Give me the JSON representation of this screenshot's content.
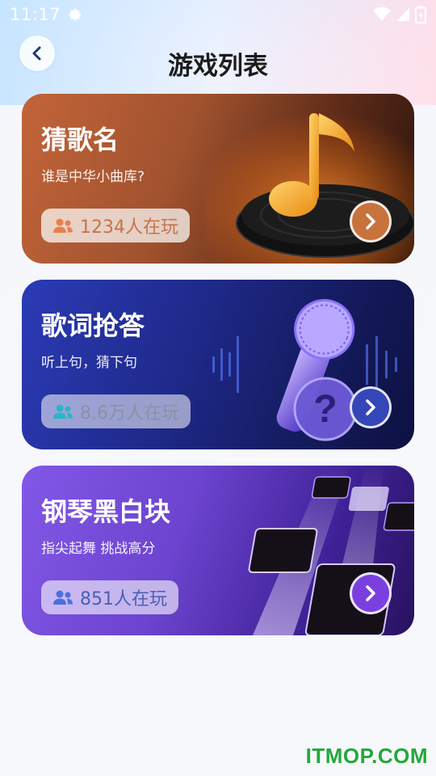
{
  "status": {
    "time": "11:17",
    "icons": [
      "gear-icon",
      "wifi-icon",
      "signal-icon",
      "battery-icon"
    ]
  },
  "header": {
    "back_icon": "chevron-left-icon",
    "title": "游戏列表"
  },
  "games": [
    {
      "title": "猜歌名",
      "subtitle": "谁是中华小曲库?",
      "players": "1234人在玩",
      "accent": "#c8733b",
      "art": "music-note-record-icon"
    },
    {
      "title": "歌词抢答",
      "subtitle": "听上句，猜下句",
      "players": "8.6万人在玩",
      "accent": "#3546b8",
      "art": "microphone-question-icon"
    },
    {
      "title": "钢琴黑白块",
      "subtitle": "指尖起舞 挑战高分",
      "players": "851人在玩",
      "accent": "#7b3fe0",
      "art": "piano-tiles-icon"
    }
  ],
  "watermark": "ITMOP.COM"
}
